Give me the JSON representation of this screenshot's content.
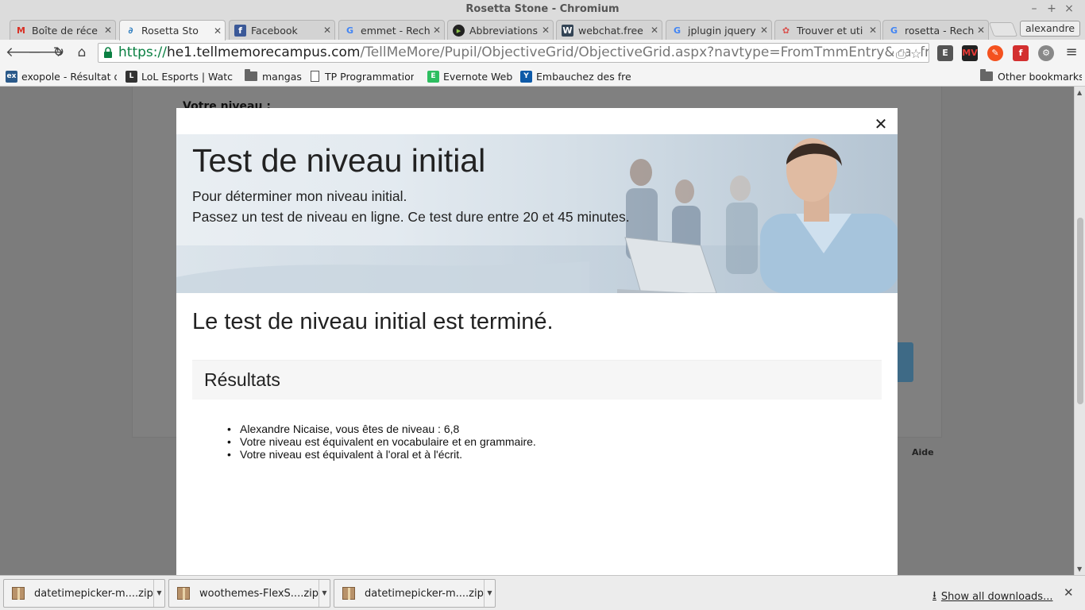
{
  "window": {
    "title": "Rosetta Stone - Chromium",
    "controls": [
      "–",
      "+",
      "×"
    ]
  },
  "tabs": [
    {
      "label": "Boîte de réce",
      "icon": "gmail-icon",
      "active": false
    },
    {
      "label": "Rosetta Sto",
      "icon": "rosetta-icon",
      "active": true
    },
    {
      "label": "Facebook",
      "icon": "facebook-icon",
      "active": false
    },
    {
      "label": "emmet - Rech",
      "icon": "google-icon",
      "active": false
    },
    {
      "label": "Abbreviations",
      "icon": "emmet-icon",
      "active": false
    },
    {
      "label": "webchat.free",
      "icon": "webchat-icon",
      "active": false
    },
    {
      "label": "jplugin jquery",
      "icon": "google-icon",
      "active": false
    },
    {
      "label": "Trouver et uti",
      "icon": "gear-red-icon",
      "active": false
    },
    {
      "label": "rosetta - Rech",
      "icon": "google-icon",
      "active": false
    }
  ],
  "profile": {
    "name": "alexandre"
  },
  "omnibox": {
    "scheme": "https://",
    "host": "he1.tellmemorecampus.com",
    "path": "/TellMeMore/Pupil/ObjectiveGrid/ObjectiveGrid.aspx?navtype=FromTmmEntry&navfron"
  },
  "bookmarks": [
    {
      "label": "exopole - Résultat d",
      "icon": "exopole-icon"
    },
    {
      "label": "LoL Esports | Watc",
      "icon": "lol-icon"
    },
    {
      "label": "mangas",
      "icon": "folder-icon"
    },
    {
      "label": "TP Programmation",
      "icon": "page-icon"
    },
    {
      "label": "Evernote Web",
      "icon": "evernote-icon"
    },
    {
      "label": "Embauchez des fre",
      "icon": "freelance-icon"
    }
  ],
  "other_bookmarks": "Other bookmarks",
  "background_page": {
    "level_label": "Votre niveau :",
    "help_label": "Aide"
  },
  "modal": {
    "title": "Test de niveau initial",
    "subtitle_1": "Pour déterminer mon niveau initial.",
    "subtitle_2": "Passez un test de niveau en ligne. Ce test dure entre 20 et 45 minutes.",
    "finished": "Le test de niveau initial est terminé.",
    "results_heading": "Résultats",
    "results": [
      "Alexandre Nicaise, vous êtes de niveau : 6,8",
      "Votre niveau est équivalent en vocabulaire et en grammaire.",
      "Votre niveau est équivalent à l'oral et à l'écrit."
    ]
  },
  "downloads": {
    "items": [
      {
        "label": "datetimepicker-m....zip"
      },
      {
        "label": "woothemes-FlexS....zip"
      },
      {
        "label": "datetimepicker-m....zip"
      }
    ],
    "show_all": "Show all downloads..."
  }
}
